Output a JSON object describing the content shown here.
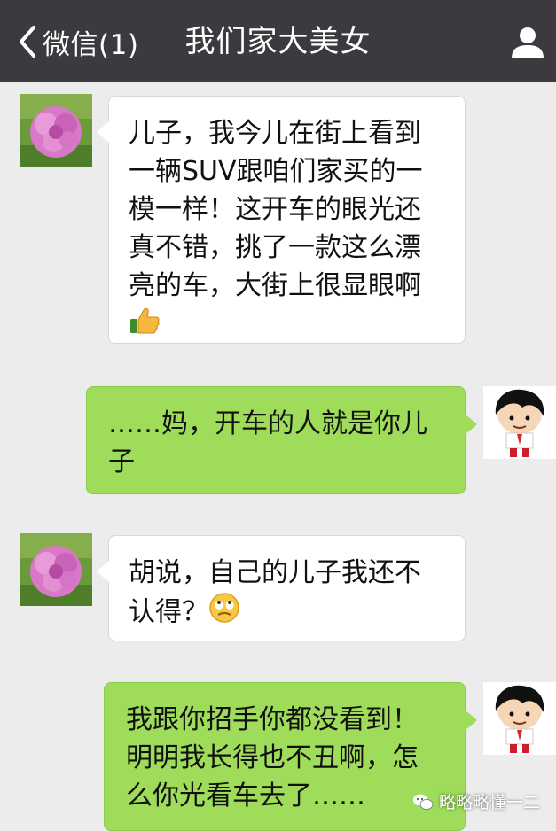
{
  "header": {
    "back_label": "微信(1)",
    "title": "我们家大美女"
  },
  "messages": [
    {
      "side": "left",
      "text": "儿子，我今儿在街上看到一辆SUV跟咱们家买的一模一样！这开车的眼光还真不错，挑了一款这么漂亮的车，大街上很显眼啊",
      "emoji": "thumbs-up-emoji"
    },
    {
      "side": "right",
      "text": "……妈，开车的人就是你儿子"
    },
    {
      "side": "left",
      "text": "胡说，自己的儿子我还不认得？",
      "emoji": "rolling-eyes-emoji"
    },
    {
      "side": "right",
      "text": "我跟你招手你都没看到！明明我长得也不丑啊，怎么你光看车去了……"
    }
  ],
  "watermark": {
    "text": "略略略懂一二",
    "icon": "wechat-official-account-icon"
  },
  "colors": {
    "topbar": "#3b3b3f",
    "chat_background": "#ececec",
    "sent_bubble": "#9edc59",
    "received_bubble": "#ffffff"
  }
}
